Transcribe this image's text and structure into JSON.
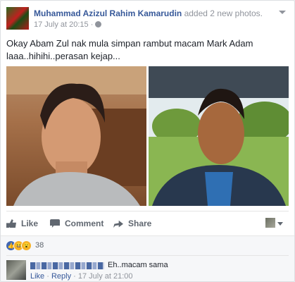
{
  "post": {
    "author": "Muhammad Azizul Rahim Kamarudin",
    "action": " added 2 new photos.",
    "time": "17 July at 20:15",
    "separator": " · ",
    "text_line1": "Okay Abam Zul nak mula simpan rambut macam Mark Adam",
    "text_line2": "laaa..hihihi..perasan kejap..."
  },
  "actions": {
    "like": "Like",
    "comment": "Comment",
    "share": "Share"
  },
  "reactions": {
    "count": "38"
  },
  "comment": {
    "text": "Eh..macam sama",
    "like": "Like",
    "dot": " · ",
    "reply": "Reply",
    "time": "17 July at 21:00"
  },
  "colors": {
    "link": "#365899",
    "accent": "#4267b2",
    "muted": "#90949c"
  }
}
